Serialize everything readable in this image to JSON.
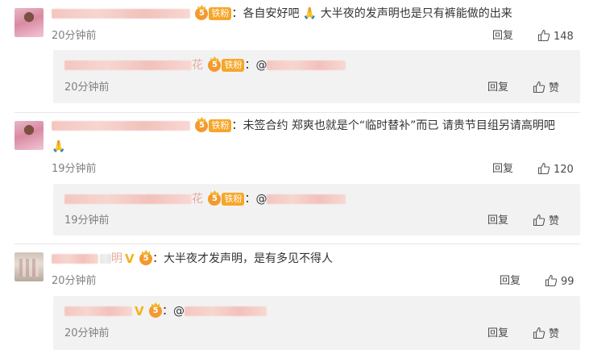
{
  "comments": [
    {
      "text": "：各自安好吧",
      "text2": " 大半夜的发声明也是只有裤能做的出来",
      "fan_badge": "铁粉",
      "time": "20分钟前",
      "reply_label": "回复",
      "like_count": "148",
      "reply": {
        "name_tail": "花",
        "fan_badge": "铁粉",
        "text": "：@",
        "time": "20分钟前",
        "reply_label": "回复",
        "like_label": "赞"
      }
    },
    {
      "text": "：未签合约 郑爽也就是个“临时替补”而已 请贵节目组另请高明吧",
      "fan_badge": "铁粉",
      "time": "19分钟前",
      "reply_label": "回复",
      "like_count": "120",
      "reply": {
        "name_tail": "花",
        "fan_badge": "铁粉",
        "text": "：@",
        "time": "19分钟前",
        "reply_label": "回复",
        "like_label": "赞"
      }
    },
    {
      "name_tail": "明",
      "text": "：大半夜才发声明，是有多见不得人",
      "time": "20分钟前",
      "reply_label": "回复",
      "like_count": "99",
      "reply": {
        "text": "：@",
        "time": "20分钟前",
        "reply_label": "回复",
        "like_label": "赞"
      }
    }
  ],
  "icons": {
    "like": "thumbs-up-icon",
    "fan_badge": "crown-badge-icon",
    "verified": "verified-v-icon",
    "emoji": "praying-hands-emoji"
  },
  "colors": {
    "fan_badge": "#f7a628",
    "reply_bg": "#f2f2f2",
    "time": "#808080"
  }
}
